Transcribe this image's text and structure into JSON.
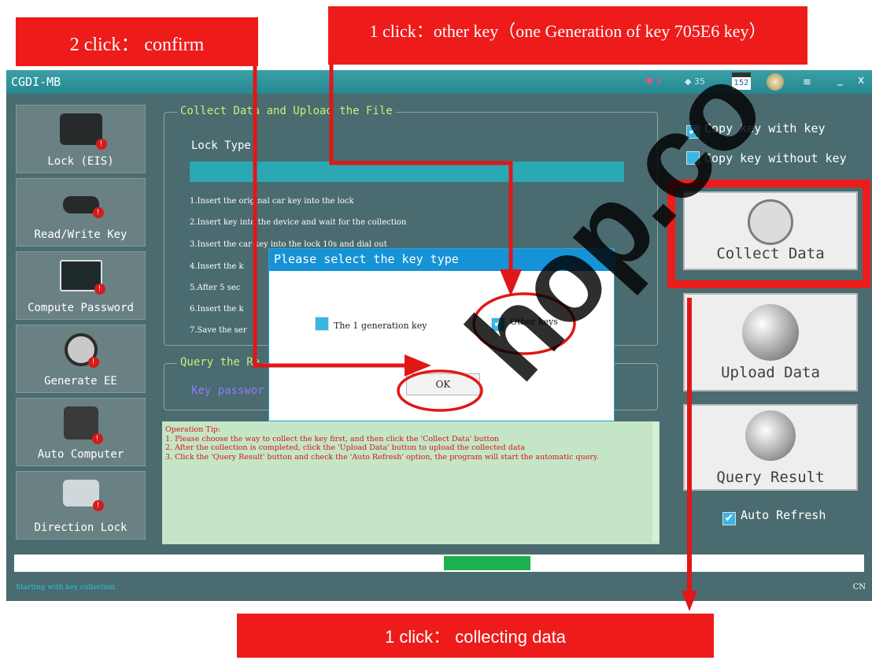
{
  "annotations": {
    "confirm": "2 click： confirm",
    "other_key": "1 click：other key（one Generation of key 705E6 key）",
    "collecting": "1 click： collecting data"
  },
  "window": {
    "title": "CGDI-MB",
    "heart_count": "3",
    "gem_count": "35",
    "calendar_text": "152",
    "menu_icon": "≡",
    "minimize_icon": "_",
    "close_icon": "x"
  },
  "sidebar": {
    "items": [
      {
        "label": "Lock (EIS)",
        "icon": "lock-icon"
      },
      {
        "label": "Read/Write Key",
        "icon": "key-icon"
      },
      {
        "label": "Compute Password",
        "icon": "monitor-icon"
      },
      {
        "label": "Generate EE",
        "icon": "printer-icon"
      },
      {
        "label": "Auto Computer",
        "icon": "chip-icon"
      },
      {
        "label": "Direction Lock",
        "icon": "steering-lock-icon"
      }
    ]
  },
  "collect_group": {
    "legend": "Collect Data and Upload the File",
    "lock_type_label": "Lock Type:",
    "steps": [
      "1.Insert the original car key into the lock",
      "2.Insert key into the device and wait for the collection",
      "3.Insert the car key into the lock 10s and dial out",
      "4.Insert the k",
      "5.After 5 sec",
      "6.Insert the k",
      "7.Save the ser"
    ]
  },
  "query_group": {
    "legend": "Query the Re",
    "key_password_label": "Key passwor"
  },
  "tips": {
    "title": "Operation Tip:",
    "items": [
      "1. Please choose the way to collect the key first, and then click the 'Collect Data' button",
      "2. After the collection is completed, click the 'Upload Data' button to upload the collected data",
      "3. Click the 'Query Result' button and check the 'Auto Refresh' option, the program will start the automatic query."
    ]
  },
  "right_panel": {
    "copy_with_key": "Copy key with key",
    "copy_with_key_checked": true,
    "copy_without_key": "Copy key without key",
    "copy_without_key_checked": false,
    "collect_data": "Collect Data",
    "upload_data": "Upload  Data",
    "query_result": "Query Result",
    "auto_refresh": "Auto Refresh",
    "auto_refresh_checked": true
  },
  "status": {
    "text": "Starting with key collection",
    "lang": "CN"
  },
  "dialog": {
    "title": "Please select the key type",
    "option_1": "The 1 generation key",
    "option_1_checked": false,
    "option_2": "Other keys",
    "option_2_checked": true,
    "ok": "OK"
  },
  "watermark": "hop.co",
  "colors": {
    "annotation_red": "#ee1b1b",
    "titlebar": "#268891",
    "window_bg": "#4a6b6f",
    "legend_text": "#c7f07a",
    "progress_green": "#1eb04c",
    "dialog_blue": "#1692d6"
  }
}
